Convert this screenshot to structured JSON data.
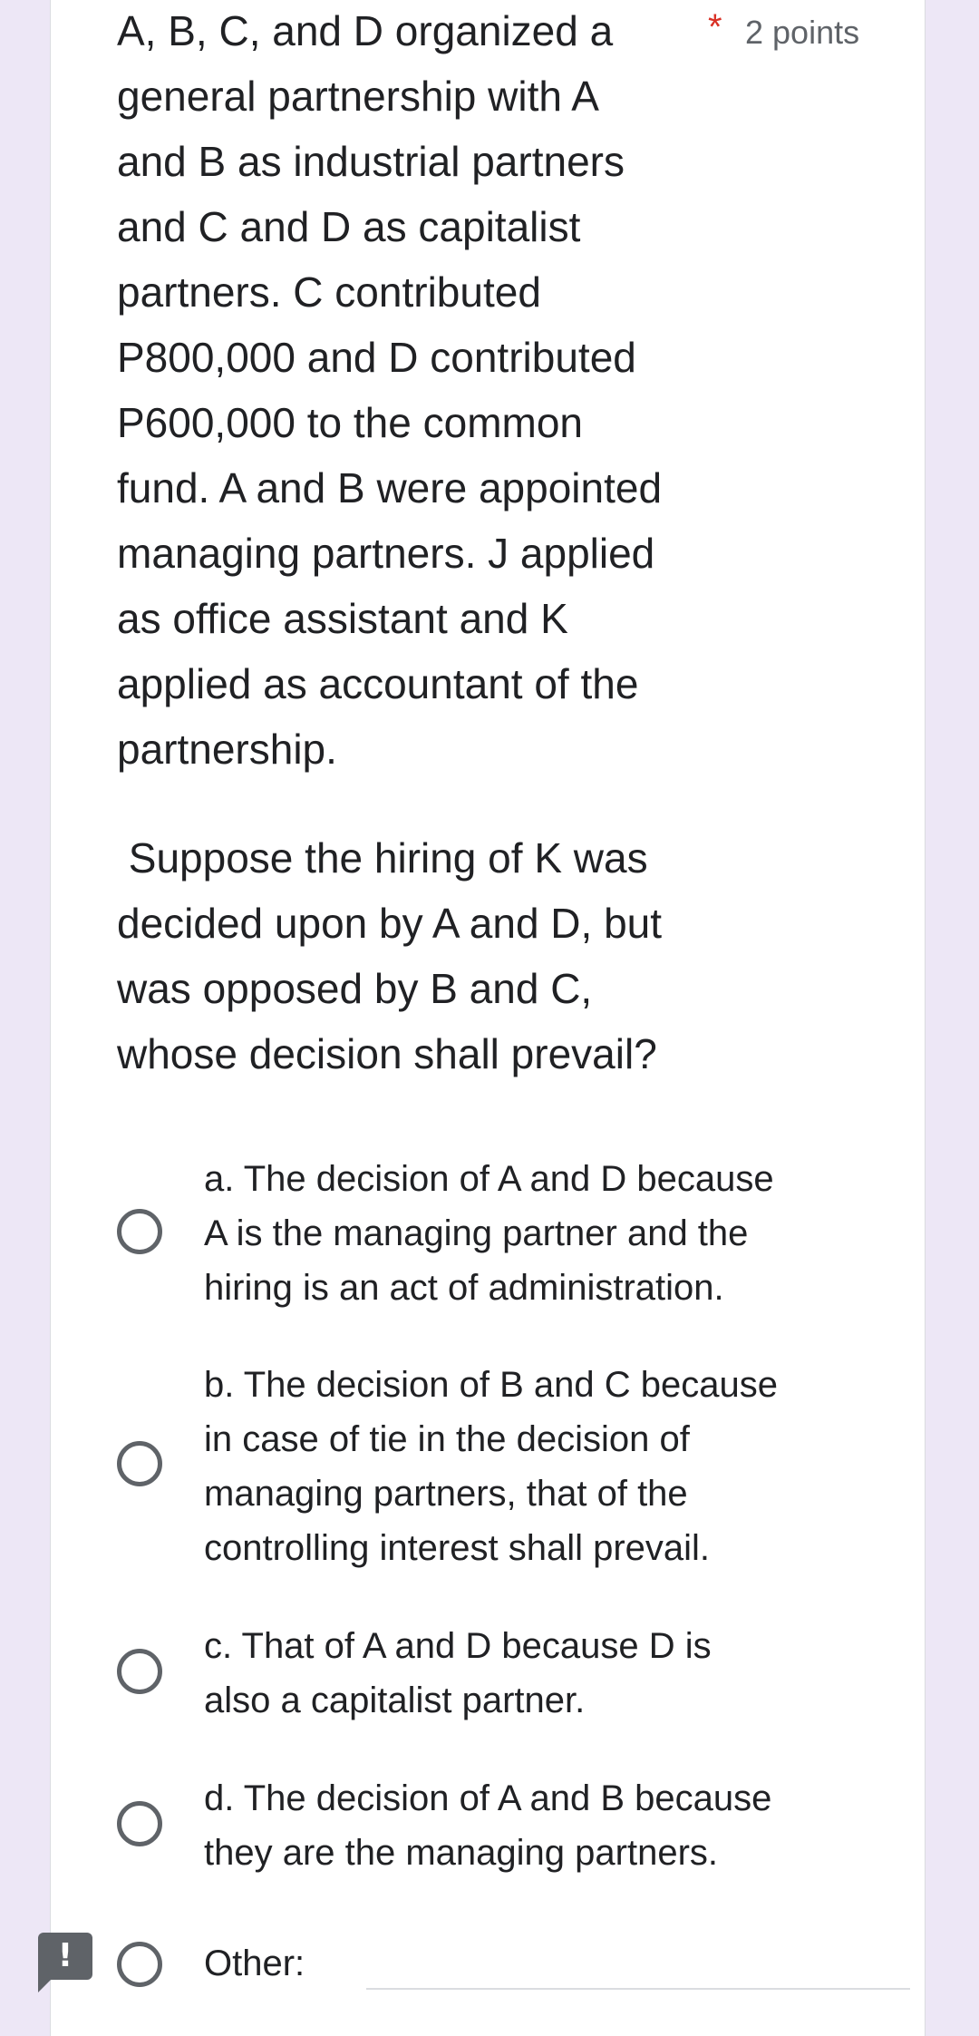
{
  "question": {
    "paragraph_1": "A, B, C, and D organized a\ngeneral partnership with A\nand B as industrial partners\nand C and D as capitalist\npartners. C contributed\nP800,000 and D contributed\nP600,000 to the common\nfund. A and B were appointed\nmanaging partners. J applied\nas office assistant and K\napplied as accountant of the\npartnership.",
    "paragraph_2": " Suppose the hiring of K was\ndecided upon by A and D, but\nwas opposed by B and C,\nwhose decision shall prevail?",
    "required_marker": "*",
    "points": "2 points"
  },
  "options": [
    {
      "label": "a. The decision of A and D because\nA is the managing partner and the\nhiring is an act of administration."
    },
    {
      "label": "b. The decision of B and C because\nin case of tie in the decision of\nmanaging partners, that of the\ncontrolling interest shall prevail."
    },
    {
      "label": "c. That of A and D because D is\nalso a capitalist partner."
    },
    {
      "label": "d. The decision of A and B because\nthey are the managing partners."
    },
    {
      "label": "Other:"
    }
  ],
  "alert_badge": {
    "mark": "!"
  },
  "colors": {
    "background": "#ede7f6",
    "required": "#d93025",
    "secondary_text": "#5f6368"
  }
}
